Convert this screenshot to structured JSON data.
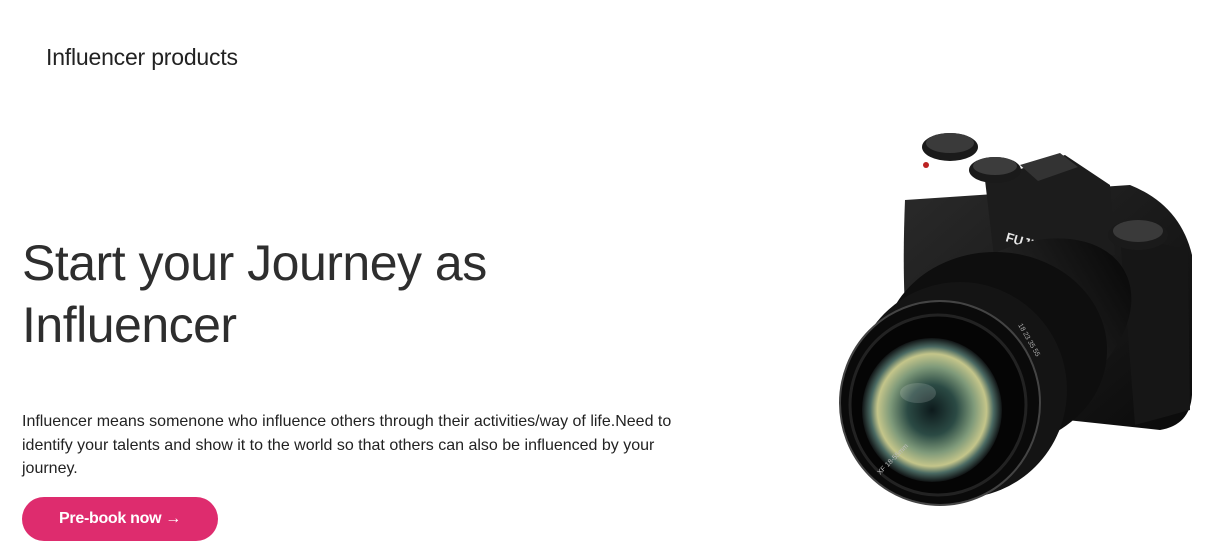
{
  "header": {
    "title": "Influencer products"
  },
  "hero": {
    "title": "Start your Journey as Influencer",
    "description": "Influencer means somenone who influence others through their activities/way of life.Need to identify your talents and show it to the world so that others can also be influenced by your journey.",
    "cta_label": "Pre-book now",
    "cta_arrow": "→"
  },
  "product_image": {
    "brand_text": "FUJIFILM",
    "model_text": "X-T10",
    "icon": "camera-image"
  },
  "colors": {
    "accent": "#de2c6e",
    "text": "#2e2e2e",
    "background": "#ffffff"
  }
}
